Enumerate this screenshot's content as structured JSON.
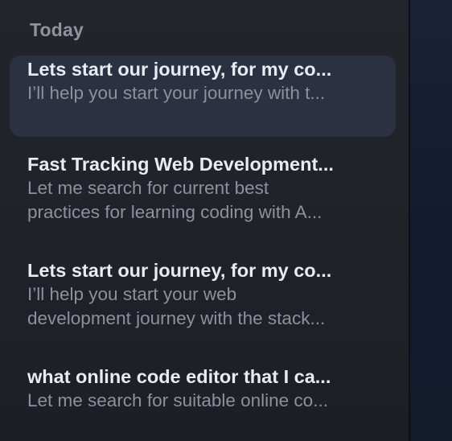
{
  "sidebar": {
    "section_header": "Today",
    "conversations": [
      {
        "title": "Lets start our journey, for my co...",
        "preview": "I’ll help you start your journey with t...",
        "active": true
      },
      {
        "title": "Fast Tracking Web Development...",
        "preview_line1": "Let me search for current best",
        "preview_line2": "practices for learning coding with A...",
        "active": false
      },
      {
        "title": "Lets start our journey, for my co...",
        "preview_line1": "I’ll help you start your web",
        "preview_line2": "development journey with the stack...",
        "active": false
      },
      {
        "title": "what online code editor that I ca...",
        "preview": "Let me search for suitable online co...",
        "active": false
      }
    ]
  },
  "colors": {
    "sidebar_bg": "#22252b",
    "active_item_bg": "#2b3140",
    "title_text": "#e8ebf0",
    "preview_text": "#8b929c",
    "header_text": "#8d949e",
    "main_bg": "#1a2238"
  }
}
